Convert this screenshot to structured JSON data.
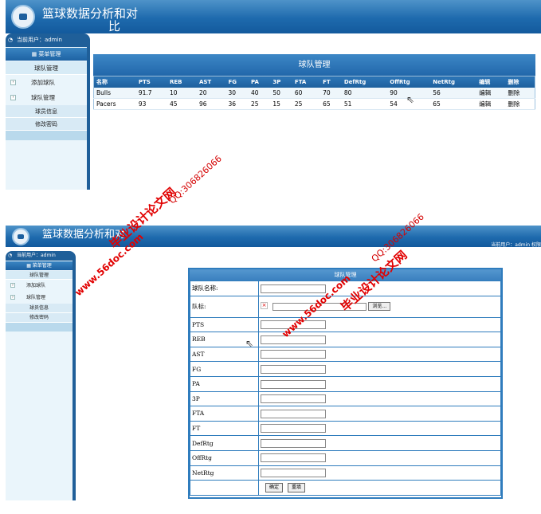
{
  "app": {
    "title_line1": "篮球数据分析和对",
    "title_line2": "比",
    "title_short": "篮球数据分析和对"
  },
  "user_bar": "当前用户：admin",
  "header_right": "当前用户：admin  权限",
  "sidebar": {
    "menu_head": "菜单管理",
    "section": "球队管理",
    "items": [
      {
        "label": "添加球队"
      },
      {
        "label": "球队管理"
      }
    ],
    "leaves": [
      "球员信息",
      "修改密码"
    ]
  },
  "list_view": {
    "title": "球队管理",
    "columns": [
      "名称",
      "PTS",
      "REB",
      "AST",
      "FG",
      "PA",
      "3P",
      "FTA",
      "FT",
      "DefRtg",
      "OffRtg",
      "NetRtg",
      "编辑",
      "删除"
    ],
    "rows": [
      [
        "Bulls",
        "91.7",
        "10",
        "20",
        "30",
        "40",
        "50",
        "60",
        "70",
        "80",
        "90",
        "56",
        "编辑",
        "删除"
      ],
      [
        "Pacers",
        "93",
        "45",
        "96",
        "36",
        "25",
        "15",
        "25",
        "65",
        "51",
        "54",
        "65",
        "编辑",
        "删除"
      ]
    ]
  },
  "form_view": {
    "title": "球队管理",
    "fields": [
      "球队名称:",
      "队标:",
      "PTS",
      "REB",
      "AST",
      "FG",
      "PA",
      "3P",
      "FTA",
      "FT",
      "DefRtg",
      "OffRtg",
      "NetRtg"
    ],
    "browse_label": "浏览...",
    "submit_label": "确定",
    "reset_label": "重填"
  },
  "watermarks": {
    "url": "www.56doc.com",
    "name": "毕业设计论文网",
    "qq": "QQ:306826066"
  },
  "colors": {
    "header_blue": "#1e6aad",
    "sidebar_bg": "#eaf5fb",
    "watermark_red": "#e10000"
  }
}
